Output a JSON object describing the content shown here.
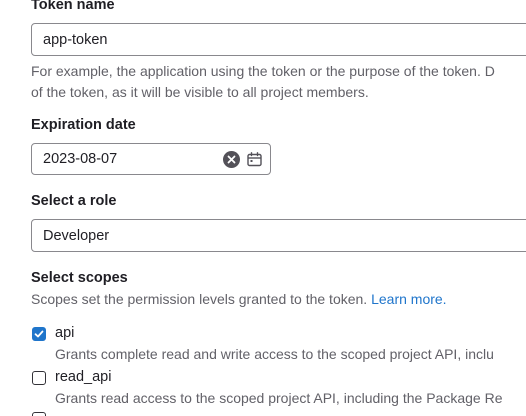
{
  "token_name": {
    "label": "Token name",
    "value": "app-token",
    "help_line1": "For example, the application using the token or the purpose of the token. D",
    "help_line2": "of the token, as it will be visible to all project members."
  },
  "expiration": {
    "label": "Expiration date",
    "value": "2023-08-07"
  },
  "role": {
    "label": "Select a role",
    "value": "Developer"
  },
  "scopes": {
    "label": "Select scopes",
    "description": "Scopes set the permission levels granted to the token.",
    "learn_more": "Learn more.",
    "items": [
      {
        "name": "api",
        "checked": true,
        "description": "Grants complete read and write access to the scoped project API, inclu"
      },
      {
        "name": "read_api",
        "checked": false,
        "description": "Grants read access to the scoped project API, including the Package Re"
      }
    ]
  },
  "colors": {
    "accent": "#1f75cb",
    "text": "#1f1e24",
    "muted": "#626168",
    "border": "#89888d"
  },
  "icons": {
    "clear": "clear-icon",
    "calendar": "calendar-icon",
    "check": "check-icon"
  }
}
